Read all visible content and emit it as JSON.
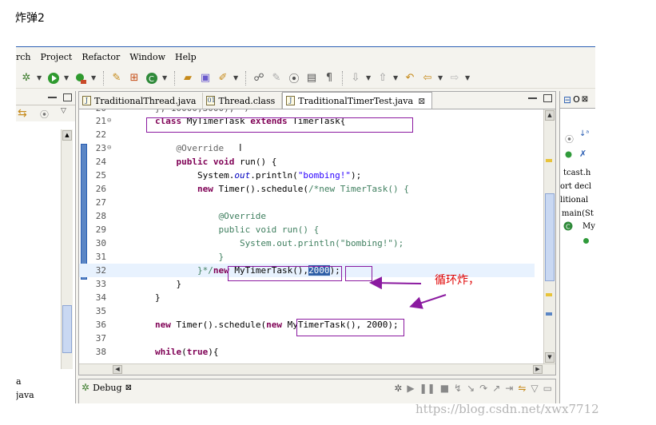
{
  "page": {
    "heading": "炸弹2"
  },
  "menubar": [
    "rch",
    "Project",
    "Refactor",
    "Window",
    "Help"
  ],
  "editor": {
    "tabs": [
      {
        "label": "TraditionalThread.java",
        "icon": "java-file-icon",
        "active": false
      },
      {
        "label": "Thread.class",
        "icon": "class-file-icon",
        "active": false
      },
      {
        "label": "TraditionalTimerTest.java",
        "icon": "java-file-icon",
        "active": true
      }
    ],
    "lines": [
      {
        "num": "21",
        "text": "        class MyTimerTask extends TimerTask{"
      },
      {
        "num": "22",
        "text": ""
      },
      {
        "num": "23",
        "text": "            @Override"
      },
      {
        "num": "24",
        "text": "            public void run() {"
      },
      {
        "num": "25",
        "text": "                System.out.println(\"bombing!\");"
      },
      {
        "num": "26",
        "text": "                new Timer().schedule(/*new TimerTask() {"
      },
      {
        "num": "27",
        "text": ""
      },
      {
        "num": "28",
        "text": "                    @Override"
      },
      {
        "num": "29",
        "text": "                    public void run() {"
      },
      {
        "num": "30",
        "text": "                        System.out.println(\"bombing!\");"
      },
      {
        "num": "31",
        "text": "                    }"
      },
      {
        "num": "32",
        "text": "                }*/new MyTimerTask(),2000);"
      },
      {
        "num": "33",
        "text": "            }"
      },
      {
        "num": "34",
        "text": "        }"
      },
      {
        "num": "35",
        "text": ""
      },
      {
        "num": "36",
        "text": "        new Timer().schedule(new MyTimerTask(), 2000);"
      },
      {
        "num": "37",
        "text": ""
      },
      {
        "num": "38",
        "text": "        while(true){"
      }
    ]
  },
  "left_panel": {
    "items": [
      "a",
      "java"
    ]
  },
  "right_panel": {
    "tab_label": "O",
    "items": [
      "tcast.h",
      "ort decl",
      "litional",
      "main(St",
      "MyI"
    ]
  },
  "debug_view": {
    "label": "Debug"
  },
  "annotation": {
    "text": "循环炸，",
    "color": "#e00000"
  },
  "watermark": "https://blog.csdn.net/xwx7712"
}
